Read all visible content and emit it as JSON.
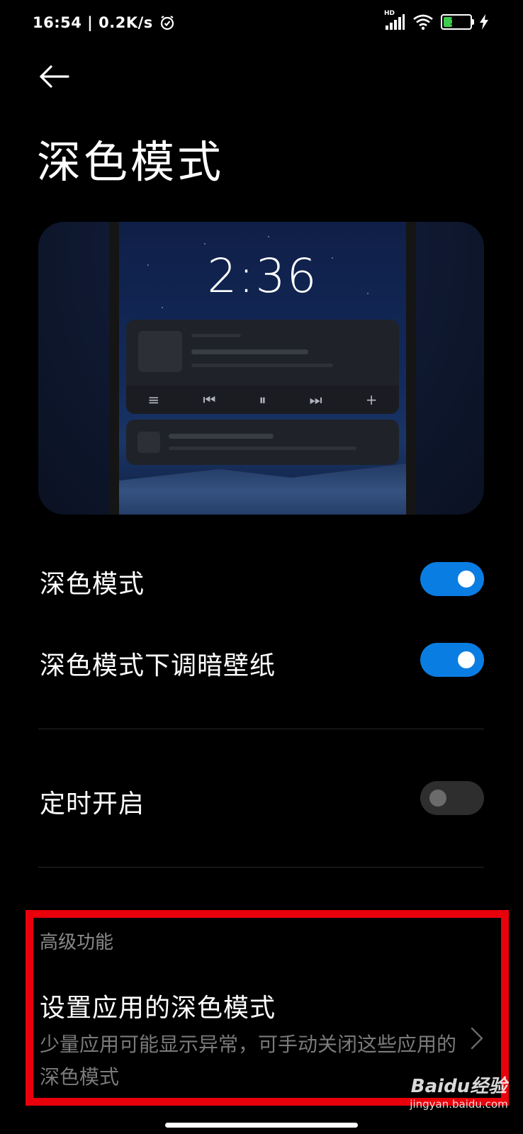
{
  "status_bar": {
    "time_speed": "16:54 | 0.2K/s",
    "network_label": "HD",
    "battery_level": "32",
    "battery_fill_fraction": 0.32,
    "battery_color": "#3ecb4f"
  },
  "header": {
    "title": "深色模式"
  },
  "preview": {
    "clock": "2:36"
  },
  "settings": {
    "dark_mode": {
      "label": "深色模式",
      "enabled": true
    },
    "dim_wallpaper": {
      "label": "深色模式下调暗壁纸",
      "enabled": true
    },
    "scheduled": {
      "label": "定时开启",
      "enabled": false
    }
  },
  "advanced": {
    "section_label": "高级功能",
    "app_dark_mode_title": "设置应用的深色模式",
    "app_dark_mode_desc": "少量应用可能显示异常，可手动关闭这些应用的深色模式"
  },
  "watermark": {
    "main": "Baidu经验",
    "sub": "jingyan.baidu.com"
  },
  "colors": {
    "accent": "#0a7de3",
    "highlight_border": "#e8000b",
    "background": "#000000"
  }
}
